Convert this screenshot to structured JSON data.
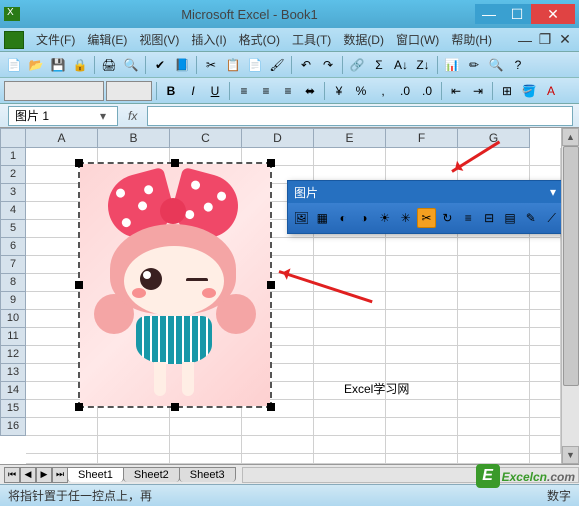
{
  "window": {
    "title": "Microsoft Excel - Book1"
  },
  "menu": {
    "items": [
      "文件(F)",
      "编辑(E)",
      "视图(V)",
      "插入(I)",
      "格式(O)",
      "工具(T)",
      "数据(D)",
      "窗口(W)",
      "帮助(H)"
    ]
  },
  "namebox": {
    "value": "图片 1",
    "fx": "fx"
  },
  "columns": [
    "A",
    "B",
    "C",
    "D",
    "E",
    "F",
    "G"
  ],
  "rows": [
    "1",
    "2",
    "3",
    "4",
    "5",
    "6",
    "7",
    "8",
    "9",
    "10",
    "11",
    "12",
    "13",
    "14",
    "15",
    "16"
  ],
  "cell_e14": "Excel学习网",
  "picture_toolbar": {
    "title": "图片",
    "buttons": [
      "insert-picture",
      "color",
      "more-contrast",
      "less-contrast",
      "more-brightness",
      "less-brightness",
      "crop",
      "rotate",
      "line-style",
      "compress",
      "text-wrap",
      "format-picture",
      "set-transparent",
      "reset"
    ]
  },
  "sheets": {
    "tabs": [
      "Sheet1",
      "Sheet2",
      "Sheet3"
    ],
    "active": 0
  },
  "status": {
    "left": "将指针置于任一控点上，再",
    "right": "数字"
  },
  "watermark": {
    "badge": "E",
    "text": "Excelcn",
    "suffix": ".com"
  },
  "chart_data": null
}
